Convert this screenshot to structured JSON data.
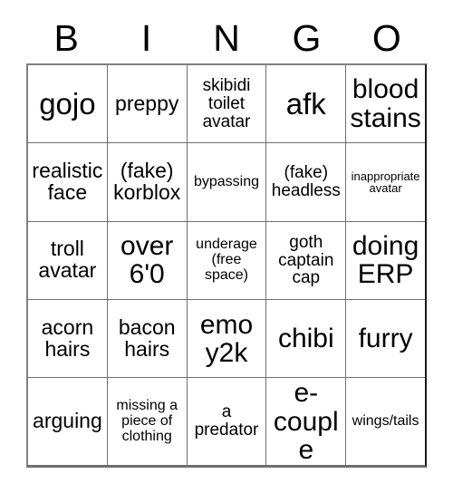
{
  "card": {
    "title_letters": [
      "B",
      "I",
      "N",
      "G",
      "O"
    ],
    "rows": [
      [
        {
          "text": "gojo",
          "size": "t-xl"
        },
        {
          "text": "preppy",
          "size": "t-md"
        },
        {
          "text": "skibidi toilet avatar",
          "size": "t-sm"
        },
        {
          "text": "afk",
          "size": "t-xl"
        },
        {
          "text": "blood stains",
          "size": "t-lg"
        }
      ],
      [
        {
          "text": "realistic face",
          "size": "t-md"
        },
        {
          "text": "(fake) korblox",
          "size": "t-md"
        },
        {
          "text": "bypassing",
          "size": "t-xs"
        },
        {
          "text": "(fake) headless",
          "size": "t-sm"
        },
        {
          "text": "inappropriate avatar",
          "size": "t-xxs"
        }
      ],
      [
        {
          "text": "troll avatar",
          "size": "t-md"
        },
        {
          "text": "over 6'0",
          "size": "t-lg"
        },
        {
          "text": "underage (free space)",
          "size": "t-xs"
        },
        {
          "text": "goth captain cap",
          "size": "t-sm"
        },
        {
          "text": "doing ERP",
          "size": "t-lg"
        }
      ],
      [
        {
          "text": "acorn hairs",
          "size": "t-md"
        },
        {
          "text": "bacon hairs",
          "size": "t-md"
        },
        {
          "text": "emo y2k",
          "size": "t-lg"
        },
        {
          "text": "chibi",
          "size": "t-lg"
        },
        {
          "text": "furry",
          "size": "t-lg"
        }
      ],
      [
        {
          "text": "arguing",
          "size": "t-md"
        },
        {
          "text": "missing a piece of clothing",
          "size": "t-xs"
        },
        {
          "text": "a predator",
          "size": "t-sm"
        },
        {
          "text": "e-couple",
          "size": "t-lg"
        },
        {
          "text": "wings/tails",
          "size": "t-xs"
        }
      ]
    ]
  },
  "colors": {
    "background": "#ffffff",
    "text": "#000000",
    "grid_line": "#707070",
    "outer_border": "#808080"
  }
}
